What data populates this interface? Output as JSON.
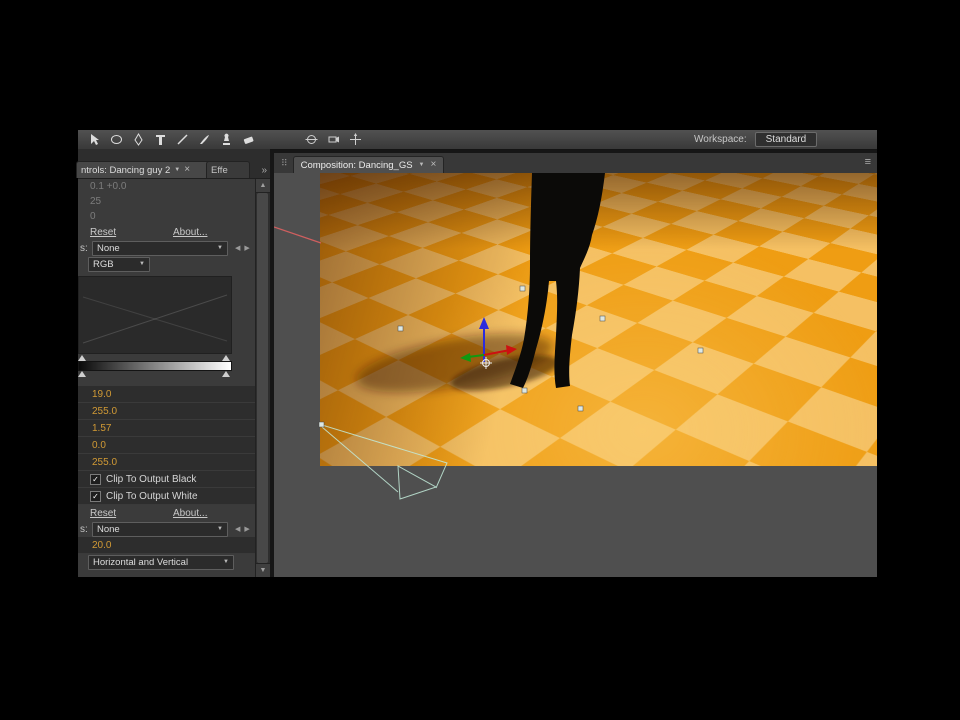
{
  "glyphs": {
    "dropdown_caret": "▼",
    "spinner_left": "◀",
    "spinner_right": "▶",
    "scroll_up": "▲",
    "scroll_down": "▼",
    "close": "×",
    "overflow": "»",
    "check": "✓",
    "panel_menu": "≡",
    "grip": "⠿"
  },
  "toolbar": {
    "workspace_label": "Workspace:",
    "workspace_value": "Standard"
  },
  "left_panel": {
    "tab_title": "ntrols: Dancing guy 2",
    "partial_tab": "Effe",
    "dim_rows": [
      "0.1 +0.0",
      "25",
      "0"
    ],
    "reset": "Reset",
    "about": "About...",
    "mask_label": "s:",
    "mask_value": "None",
    "channel_value": "RGB",
    "values": [
      "19.0",
      "255.0",
      "1.57",
      "0.0",
      "255.0"
    ],
    "clip_black_label": "Clip To Output Black",
    "clip_white_label": "Clip To Output White",
    "reset2": "Reset",
    "about2": "About...",
    "mask2_label": "s:",
    "mask2_value": "None",
    "blurriness": "20.0",
    "dimensions": "Horizontal and Vertical"
  },
  "comp_panel": {
    "tab_title": "Composition: Dancing_GS"
  },
  "colors": {
    "value_orange": "#d19a35",
    "floor_dark": "#ef9d13",
    "floor_light": "#f5c063",
    "wireframe_cyan": "#c2ead9",
    "gizmo_blue": "#2b2bdd",
    "gizmo_red": "#cc1111",
    "gizmo_green": "#119911"
  }
}
